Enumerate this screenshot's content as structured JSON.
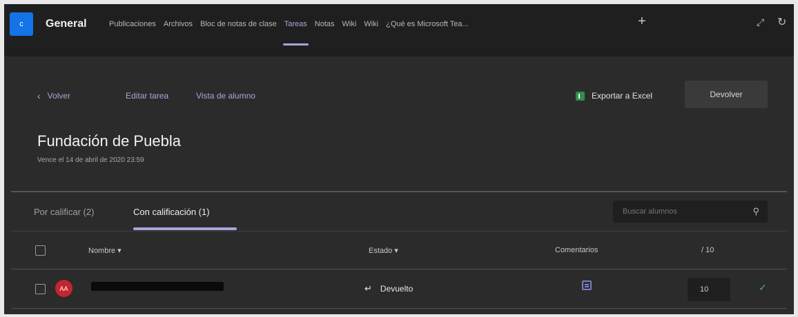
{
  "team": {
    "avatar_letter": "c",
    "channel_name": "General"
  },
  "tabs": [
    {
      "label": "Publicaciones",
      "active": false
    },
    {
      "label": "Archivos",
      "active": false
    },
    {
      "label": "Bloc de notas de clase",
      "active": false
    },
    {
      "label": "Tareas",
      "active": true
    },
    {
      "label": "Notas",
      "active": false
    },
    {
      "label": "Wiki",
      "active": false
    },
    {
      "label": "Wiki",
      "active": false
    },
    {
      "label": "¿Qué es Microsoft Tea...",
      "active": false
    }
  ],
  "toolbar": {
    "add_tab_glyph": "+",
    "expand_glyph": "⤢",
    "refresh_glyph": "↻"
  },
  "nav": {
    "back_glyph": "‹",
    "back_label": "Volver",
    "edit_label": "Editar tarea",
    "student_view_label": "Vista de alumno"
  },
  "actions": {
    "export_label": "Exportar a Excel",
    "return_label": "Devolver"
  },
  "assignment": {
    "title": "Fundación de Puebla",
    "due": "Vence el 14 de abril de 2020 23:59"
  },
  "grading_tabs": {
    "to_grade": "Por calificar (2)",
    "graded": "Con calificación (1)"
  },
  "search": {
    "placeholder": "Buscar alumnos",
    "icon": "search-icon"
  },
  "table": {
    "columns": {
      "name": "Nombre ▾",
      "state": "Estado ▾",
      "comments": "Comentarios",
      "max": "/ 10"
    },
    "rows": [
      {
        "initials": "AA",
        "status_glyph": "↵",
        "status": "Devuelto",
        "grade": "10"
      }
    ]
  },
  "colors": {
    "accent": "#a6a7dc",
    "avatar": "#c4262e",
    "excel": "#2e8f4c",
    "check": "#3fb26b",
    "team_tile": "#1473e6"
  },
  "check_glyph": "✓"
}
